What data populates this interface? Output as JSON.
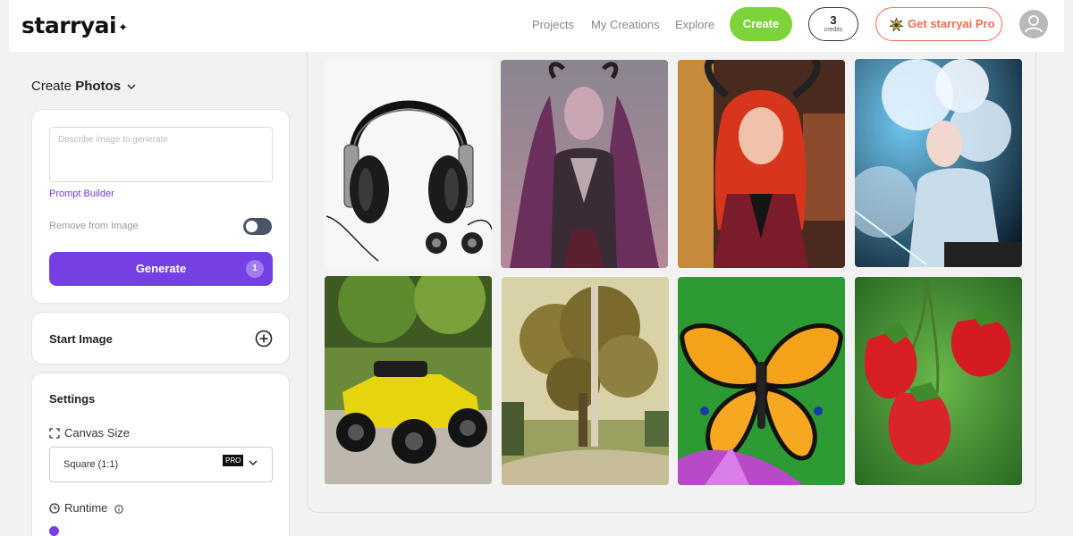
{
  "header": {
    "logo": "starryai",
    "nav": [
      "Projects",
      "My Creations",
      "Explore"
    ],
    "create_label": "Create",
    "credits_count": "3",
    "credits_label": "credits",
    "pro_label": "Get starryai Pro"
  },
  "sidebar": {
    "mode_prefix": "Create",
    "mode_value": "Photos",
    "prompt_placeholder": "Describe image to generate",
    "prompt_builder": "Prompt Builder",
    "remove_from_image": "Remove from Image",
    "remove_enabled": false,
    "generate_label": "Generate",
    "generate_badge": "1",
    "start_image": "Start Image",
    "settings_title": "Settings",
    "canvas_size_label": "Canvas Size",
    "canvas_size_value": "Square (1:1)",
    "canvas_pro_badge": "PRO",
    "runtime_label": "Runtime"
  },
  "colors": {
    "accent_purple": "#7440e3",
    "create_green": "#7fd33a",
    "pro_orange": "#f26d4f"
  },
  "gallery": {
    "images": [
      "headphones-image",
      "demon-woman-image",
      "red-hair-horned-girl-image",
      "white-hair-warrior-image",
      "yellow-atv-image",
      "tree-landscape-image",
      "butterfly-image",
      "strawberries-image"
    ]
  }
}
